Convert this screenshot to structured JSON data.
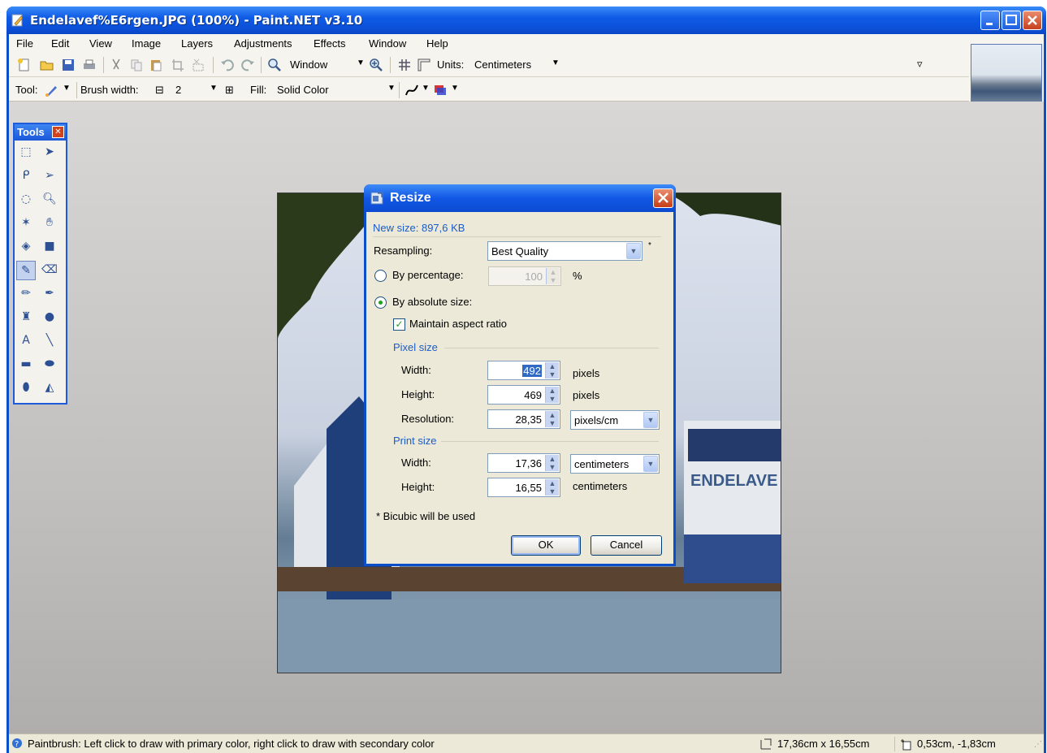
{
  "window": {
    "title": "Endelavef%E6rgen.JPG (100%) - Paint.NET v3.10"
  },
  "menu": [
    "File",
    "Edit",
    "View",
    "Image",
    "Layers",
    "Adjustments",
    "Effects",
    "Window",
    "Help"
  ],
  "toolbar": {
    "zoom_value": "Window",
    "units_label": "Units:",
    "units_value": "Centimeters",
    "tool_label": "Tool:",
    "brush_width_label": "Brush width:",
    "brush_width_value": "2",
    "fill_label": "Fill:",
    "fill_value": "Solid Color"
  },
  "tools_window": {
    "title": "Tools",
    "tools": [
      "rectangle-select-icon",
      "move-selection-icon",
      "lasso-select-icon",
      "move-selection-only-icon",
      "ellipse-select-icon",
      "zoom-icon",
      "magic-wand-icon",
      "pan-icon",
      "paint-bucket-icon",
      "gradient-icon",
      "paintbrush-icon",
      "eraser-icon",
      "pencil-icon",
      "color-picker-icon",
      "clone-stamp-icon",
      "recolor-icon",
      "text-icon",
      "line-curve-icon",
      "rectangle-icon",
      "rounded-rectangle-icon",
      "ellipse-icon",
      "freeform-shape-icon"
    ]
  },
  "dialog": {
    "title": "Resize",
    "new_size": "New size: 897,6 KB",
    "resampling_label": "Resampling:",
    "resampling_value": "Best Quality",
    "asterisk": "*",
    "by_percentage_label": "By percentage:",
    "percentage_value": "100",
    "percent_sign": "%",
    "by_absolute_label": "By absolute size:",
    "maintain_aspect_label": "Maintain aspect ratio",
    "pixel_size_header": "Pixel size",
    "width_label": "Width:",
    "width_value": "492",
    "pixels_unit": "pixels",
    "height_label": "Height:",
    "height_value": "469",
    "resolution_label": "Resolution:",
    "resolution_value": "28,35",
    "resolution_unit": "pixels/cm",
    "print_size_header": "Print size",
    "print_width_value": "17,36",
    "print_width_unit": "centimeters",
    "print_height_value": "16,55",
    "print_height_unit": "centimeters",
    "note": "* Bicubic will be used",
    "ok_label": "OK",
    "cancel_label": "Cancel",
    "percentage_selected": false,
    "absolute_selected": true,
    "maintain_aspect_checked": true
  },
  "status": {
    "hint": "Paintbrush: Left click to draw with primary color, right click to draw with secondary color",
    "image_size": "17,36cm x 16,55cm",
    "cursor_pos": "0,53cm, -1,83cm"
  },
  "canvas": {
    "ship_label": "ENDELAVE"
  },
  "colors": {
    "title_blue": "#0a4ec9",
    "close_red": "#c6401d",
    "accent_blue_text": "#1b5cc9",
    "check_green": "#21a121"
  }
}
